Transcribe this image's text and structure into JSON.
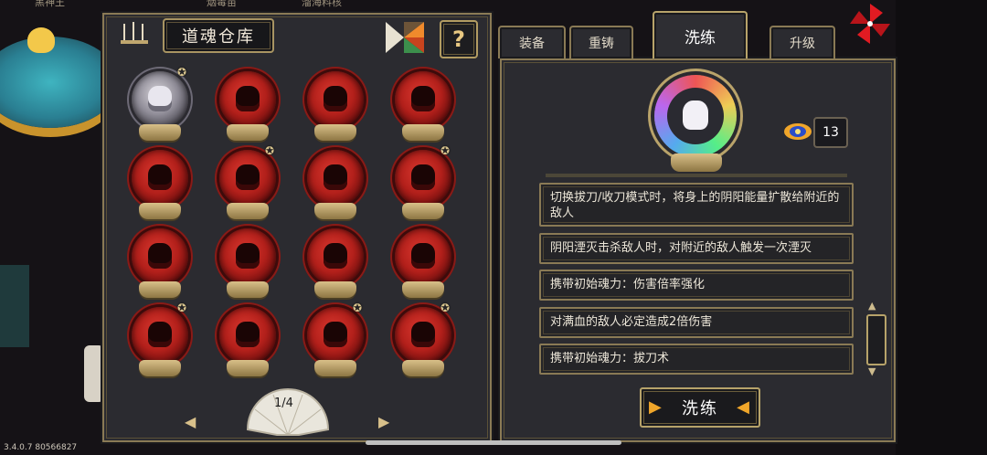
{
  "background": {
    "top_labels": [
      "黑神王",
      "烟毒苗",
      "溜海料核"
    ],
    "version": "3.4.0.7 80566827"
  },
  "storage": {
    "title": "道魂仓库",
    "help_label": "?",
    "pager": {
      "current_page": 1,
      "total_pages": 4,
      "display": "1/4"
    },
    "orbs": [
      {
        "style": "silver",
        "starred": true
      },
      {
        "style": "red",
        "starred": false
      },
      {
        "style": "red",
        "starred": false
      },
      {
        "style": "red",
        "starred": false
      },
      {
        "style": "red",
        "starred": false
      },
      {
        "style": "red",
        "starred": true
      },
      {
        "style": "red",
        "starred": false
      },
      {
        "style": "red",
        "starred": true
      },
      {
        "style": "red",
        "starred": false
      },
      {
        "style": "red",
        "starred": false
      },
      {
        "style": "red",
        "starred": false
      },
      {
        "style": "red",
        "starred": false
      },
      {
        "style": "red",
        "starred": true
      },
      {
        "style": "red",
        "starred": false
      },
      {
        "style": "red",
        "starred": true
      },
      {
        "style": "red",
        "starred": true
      }
    ]
  },
  "detail": {
    "tabs": [
      {
        "label": "装备",
        "active": false
      },
      {
        "label": "重铸",
        "active": false
      },
      {
        "label": "洗练",
        "active": true
      },
      {
        "label": "升级",
        "active": false
      }
    ],
    "cost": {
      "icon": "eye-gem-icon",
      "count": "13"
    },
    "attributes": [
      "切换拔刀/收刀模式时，将身上的阴阳能量扩散给附近的敌人",
      "阴阳湮灭击杀敌人时，对附近的敌人触发一次湮灭",
      "携带初始魂力：伤害倍率强化",
      "对满血的敌人必定造成2倍伤害",
      "携带初始魂力：拔刀术"
    ],
    "refine_button": "洗练"
  },
  "colors": {
    "panel": "#2b2b30",
    "gold_border": "#8a7a55",
    "orb_red": "#b3201b",
    "accent_orange": "#f0a62a"
  }
}
